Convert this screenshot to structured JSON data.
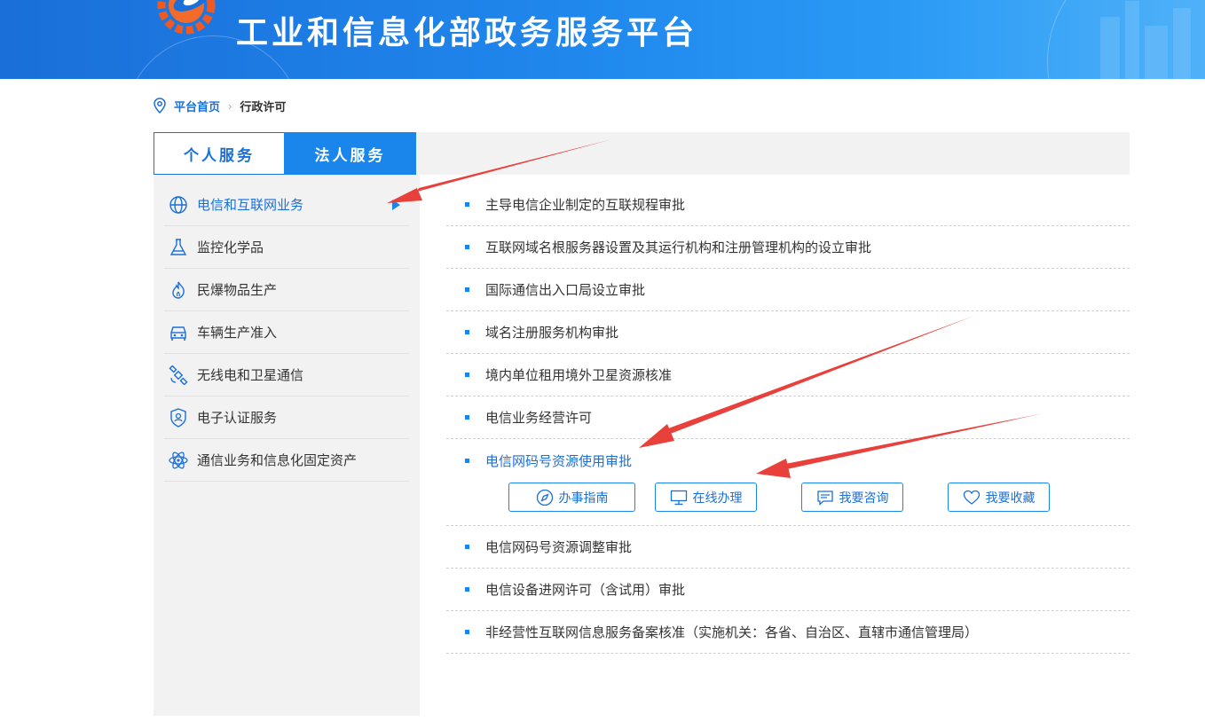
{
  "header": {
    "site_title": "工业和信息化部政务服务平台",
    "logo": "gear-logo-icon",
    "colors": {
      "banner_start": "#1a6fd8",
      "banner_end": "#4fb1f8"
    }
  },
  "breadcrumb": {
    "icon": "location-pin-icon",
    "home": "平台首页",
    "current": "行政许可"
  },
  "tabs": [
    {
      "label": "个人服务",
      "active": false
    },
    {
      "label": "法人服务",
      "active": true
    }
  ],
  "sidebar": {
    "items": [
      {
        "label": "电信和互联网业务",
        "icon": "globe-icon",
        "active": true
      },
      {
        "label": "监控化学品",
        "icon": "flask-icon",
        "active": false
      },
      {
        "label": "民爆物品生产",
        "icon": "flame-icon",
        "active": false
      },
      {
        "label": "车辆生产准入",
        "icon": "car-icon",
        "active": false
      },
      {
        "label": "无线电和卫星通信",
        "icon": "satellite-icon",
        "active": false
      },
      {
        "label": "电子认证服务",
        "icon": "shield-user-icon",
        "active": false
      },
      {
        "label": "通信业务和信息化固定资产",
        "icon": "atom-icon",
        "active": false
      }
    ]
  },
  "services": [
    {
      "label": "主导电信企业制定的互联规程审批"
    },
    {
      "label": "互联网域名根服务器设置及其运行机构和注册管理机构的设立审批"
    },
    {
      "label": "国际通信出入口局设立审批"
    },
    {
      "label": "域名注册服务机构审批"
    },
    {
      "label": "境内单位租用境外卫星资源核准"
    },
    {
      "label": "电信业务经营许可"
    },
    {
      "label": "电信网码号资源使用审批",
      "active": true
    },
    {
      "label": "电信网码号资源调整审批"
    },
    {
      "label": "电信设备进网许可（含试用）审批"
    },
    {
      "label": "非经营性互联网信息服务备案核准（实施机关：各省、自治区、直辖市通信管理局）"
    }
  ],
  "actions": [
    {
      "label": "办事指南",
      "icon": "compass-icon"
    },
    {
      "label": "在线办理",
      "icon": "monitor-icon"
    },
    {
      "label": "我要咨询",
      "icon": "message-icon"
    },
    {
      "label": "我要收藏",
      "icon": "heart-icon"
    }
  ],
  "accent": "#1a86ec",
  "annotation_color": "#e8403a"
}
